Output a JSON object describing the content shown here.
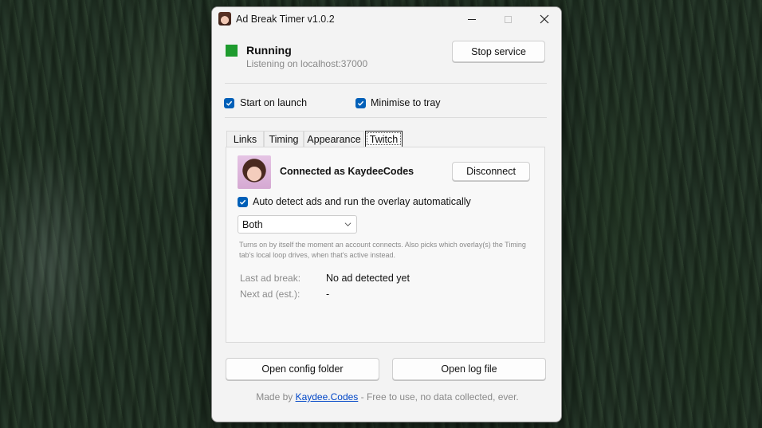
{
  "window": {
    "title": "Ad Break Timer v1.0.2"
  },
  "status": {
    "title": "Running",
    "subtitle": "Listening on localhost:37000",
    "indicator_color": "#1e9b2e",
    "stop_label": "Stop service"
  },
  "options": {
    "start_on_launch": {
      "label": "Start on launch",
      "checked": true
    },
    "minimise_to_tray": {
      "label": "Minimise to tray",
      "checked": true
    }
  },
  "tabs": [
    {
      "label": "Links"
    },
    {
      "label": "Timing"
    },
    {
      "label": "Appearance"
    },
    {
      "label": "Twitch",
      "active": true
    }
  ],
  "twitch": {
    "connected_text": "Connected as KaydeeCodes",
    "disconnect_label": "Disconnect",
    "auto_detect": {
      "label": "Auto detect ads and run the overlay automatically",
      "checked": true
    },
    "overlay_select": {
      "value": "Both"
    },
    "hint": "Turns on by itself the moment an account connects. Also picks which overlay(s) the Timing tab's local loop drives, when that's active instead.",
    "last_ad_label": "Last ad break:",
    "last_ad_value": "No ad detected yet",
    "next_ad_label": "Next ad (est.):",
    "next_ad_value": "-"
  },
  "actions": {
    "open_config": "Open config folder",
    "open_log": "Open log file"
  },
  "footer": {
    "prefix": "Made by ",
    "link": "Kaydee.Codes",
    "suffix": " - Free to use, no data collected, ever."
  },
  "colors": {
    "accent": "#005fb8",
    "link": "#0046c7"
  }
}
